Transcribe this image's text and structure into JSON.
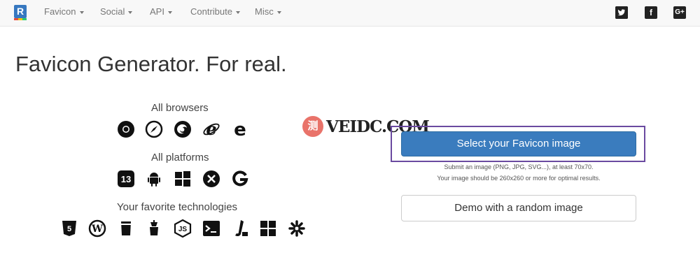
{
  "navbar": {
    "brand_letter": "R",
    "items": [
      {
        "label": "Favicon"
      },
      {
        "label": "Social"
      },
      {
        "label": "API"
      },
      {
        "label": "Contribute"
      },
      {
        "label": "Misc"
      }
    ],
    "social": [
      {
        "icon": "twitter-icon"
      },
      {
        "icon": "facebook-icon",
        "glyph": "f"
      },
      {
        "icon": "google-plus-icon",
        "glyph": "G+"
      }
    ]
  },
  "main": {
    "title": "Favicon Generator. For real.",
    "browsers_label": "All browsers",
    "platforms_label": "All platforms",
    "technologies_label": "Your favorite technologies",
    "browser_icons": [
      "chrome-icon",
      "safari-icon",
      "firefox-icon",
      "ie-icon",
      "edge-icon"
    ],
    "platform_icons": [
      "ios-icon",
      "android-icon",
      "windows-icon",
      "macos-icon",
      "google-icon"
    ],
    "platform_glyphs": {
      "ios": "13"
    },
    "technology_icons": [
      "html5-icon",
      "wordpress-icon",
      "gulp-icon",
      "grunt-icon",
      "nodejs-icon",
      "cli-icon",
      "jekyll-icon",
      "windows-store-icon",
      "joomla-icon"
    ],
    "select_button": "Select your Favicon image",
    "hint_line1": "Submit an image (PNG, JPG, SVG...), at least 70x70.",
    "hint_line2": "Your image should be 260x260 or more for optimal results.",
    "demo_button": "Demo with a random image"
  },
  "watermark": {
    "circle_text": "测",
    "text": "VEIDC.COM"
  },
  "colors": {
    "primary": "#3a7cbe",
    "highlight": "#6a4aa0",
    "watermark": "#e9736a"
  }
}
